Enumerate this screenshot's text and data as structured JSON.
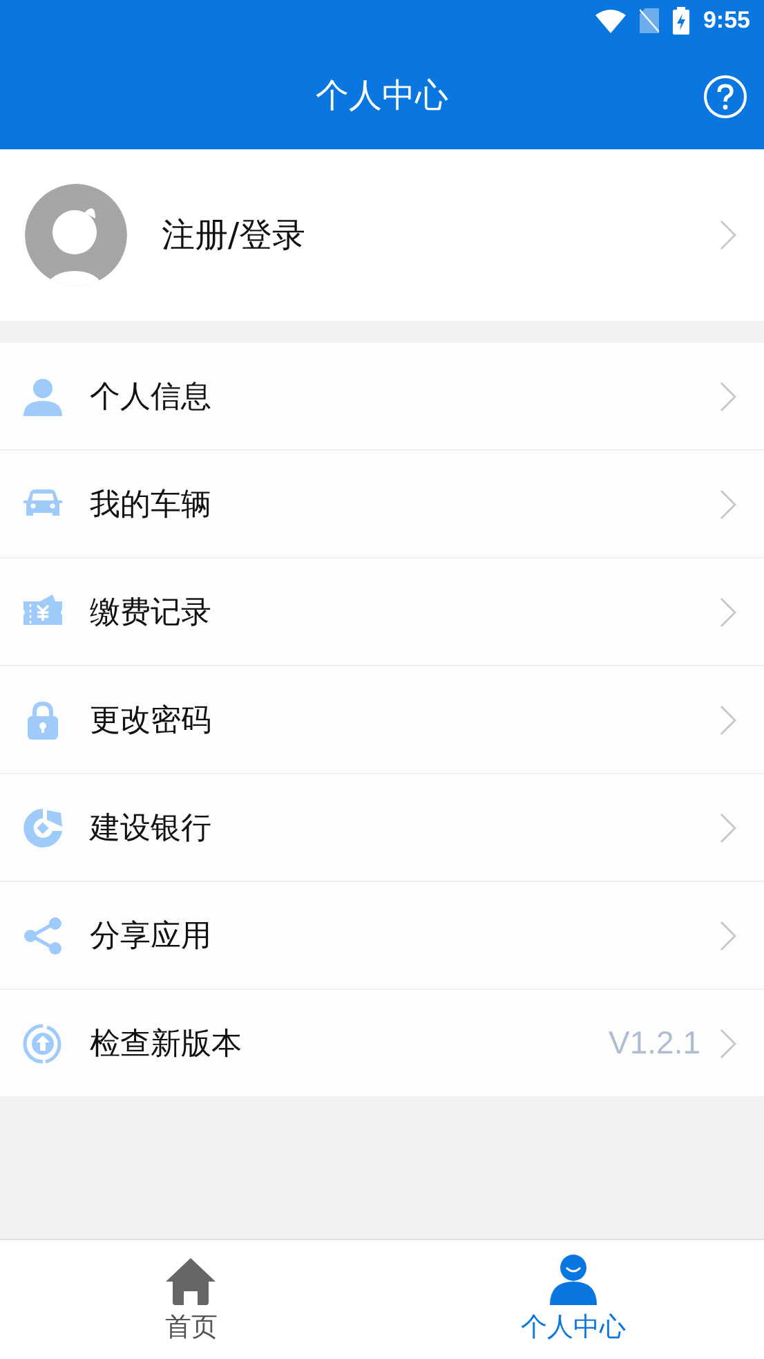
{
  "status_bar": {
    "time": "9:55"
  },
  "header": {
    "title": "个人中心"
  },
  "profile": {
    "label": "注册/登录"
  },
  "menu": [
    {
      "kind": "person",
      "label": "个人信息"
    },
    {
      "kind": "car",
      "label": "我的车辆"
    },
    {
      "kind": "ticket",
      "label": "缴费记录"
    },
    {
      "kind": "lock",
      "label": "更改密码"
    },
    {
      "kind": "bank",
      "label": "建设银行"
    },
    {
      "kind": "share",
      "label": "分享应用"
    },
    {
      "kind": "update",
      "label": "检查新版本",
      "value": "V1.2.1"
    }
  ],
  "tabs": [
    {
      "kind": "home",
      "label": "首页",
      "selected": false
    },
    {
      "kind": "person",
      "label": "个人中心",
      "selected": true
    }
  ]
}
